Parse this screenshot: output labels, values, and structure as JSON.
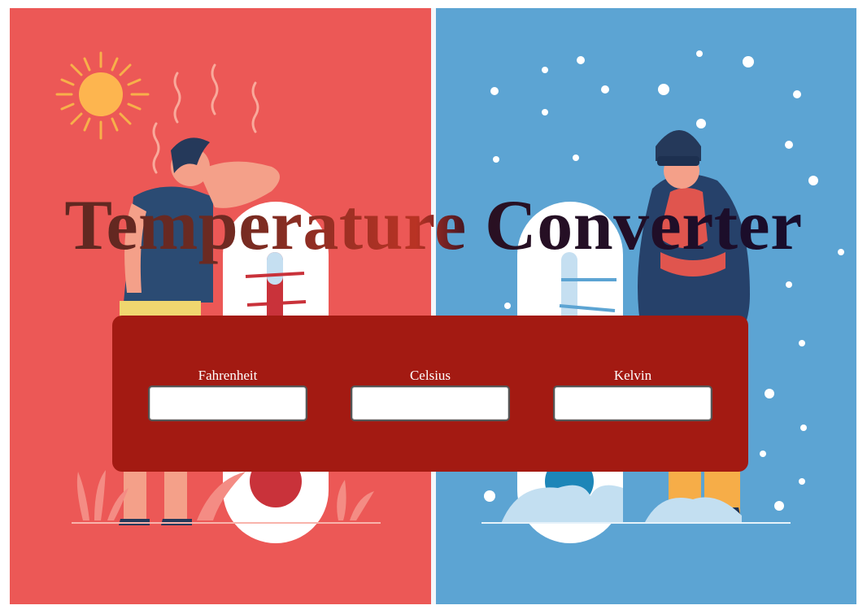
{
  "page": {
    "title": "Temperature Converter"
  },
  "converter": {
    "fields": [
      {
        "label": "Fahrenheit",
        "value": "",
        "placeholder": ""
      },
      {
        "label": "Celsius",
        "value": "",
        "placeholder": ""
      },
      {
        "label": "Kelvin",
        "value": "",
        "placeholder": ""
      }
    ]
  },
  "colors": {
    "hot_background": "#ec5856",
    "cold_background": "#5ca4d3",
    "panel": "#a31a12",
    "title_dark": "#140c2e"
  },
  "illustration": {
    "hot_side": [
      "sun-icon",
      "heat-waves",
      "hot-person",
      "thermometer-high",
      "plants"
    ],
    "cold_side": [
      "snowflakes",
      "cold-person",
      "thermometer-low",
      "snow-mound"
    ]
  }
}
